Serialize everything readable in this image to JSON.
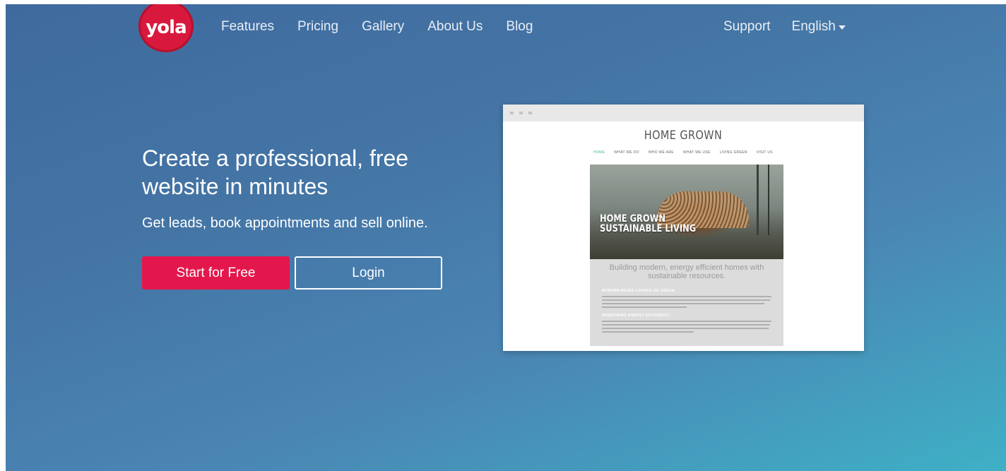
{
  "nav": {
    "logo_text": "yola",
    "links": [
      "Features",
      "Pricing",
      "Gallery",
      "About Us",
      "Blog"
    ],
    "support": "Support",
    "language": "English"
  },
  "hero": {
    "title": "Create a professional, free website in minutes",
    "subtitle": "Get leads, book appointments and sell online.",
    "start_button": "Start for Free",
    "login_button": "Login"
  },
  "preview": {
    "site_title": "HOME GROWN",
    "site_nav": [
      "HOME",
      "WHAT WE DO",
      "WHO WE ARE",
      "WHAT WE USE",
      "LIVING GREEN",
      "VISIT US"
    ],
    "image_headline_1": "HOME GROWN",
    "image_headline_2": "SUSTAINABLE LIVING",
    "lead_1": "Building modern, energy efficient homes with",
    "lead_2": "sustainable resources.",
    "section_1": "MODERN NEVER LOOKED SO GREEN.",
    "section_2": "REDEFINING ENERGY EFFICIENCY."
  },
  "colors": {
    "accent": "#e3174b",
    "logo": "#d8193d",
    "active_nav": "#3fb8a0"
  }
}
